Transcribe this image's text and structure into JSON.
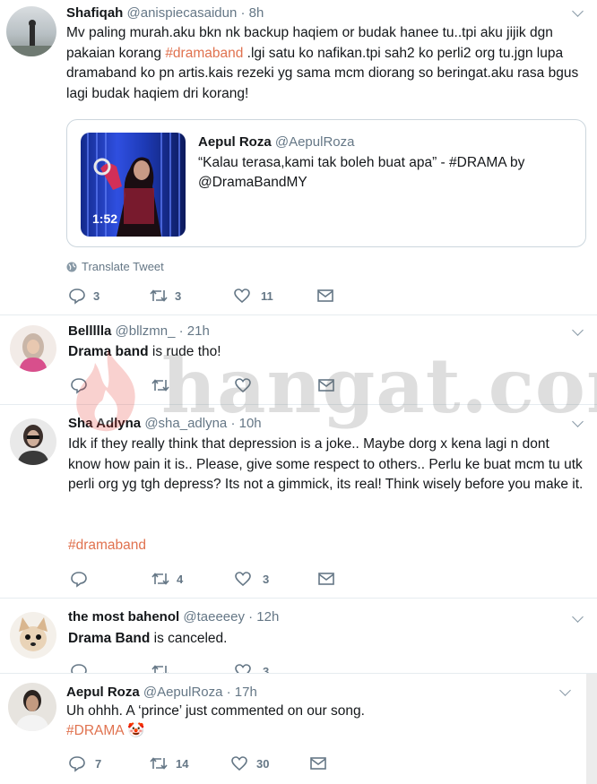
{
  "tweets": [
    {
      "name": "Shafiqah",
      "handle": "@anispiecasaidun",
      "time": "· 8h",
      "text_parts": [
        "Mv paling murah.aku bkn nk backup haqiem or budak hanee tu..tpi aku jijik dgn pakaian korang ",
        "#dramaband",
        " .lgi satu ko nafikan.tpi sah2 ko perli2 org tu.jgn lupa dramaband ko pn artis.kais rezeki yg sama mcm diorang so beringat.aku rasa bgus lagi budak haqiem dri korang!"
      ],
      "quote": {
        "name": "Aepul Roza",
        "handle": "@AepulRoza",
        "text": "“Kalau terasa,kami tak boleh buat apa” - #DRAMA by @DramaBandMY",
        "duration": "1:52"
      },
      "translate": "Translate Tweet",
      "replies": "3",
      "retweets": "3",
      "likes": "11"
    },
    {
      "name": "Bellllla",
      "handle": "@bllzmn_",
      "time": "· 21h",
      "text_bold": "Drama band",
      "text_rest": " is rude tho!"
    },
    {
      "name": "Sha Adlyna",
      "handle": "@sha_adlyna",
      "time": "· 10h",
      "text": "Idk if they really think that depression is a joke.. Maybe dorg x kena lagi n dont know how pain it is.. Please, give some respect to others.. Perlu ke buat mcm tu utk perli org yg tgh depress? Its not a gimmick, its real! Think wisely before you make it.",
      "hashtag": "#dramaband",
      "retweets": "4",
      "likes": "3"
    },
    {
      "name": "the most bahenol",
      "handle": "@taeeeey",
      "time": "· 12h",
      "text_bold": "Drama Band",
      "text_rest": " is canceled.",
      "likes": "3"
    },
    {
      "name": "Aepul Roza",
      "handle": "@AepulRoza",
      "time": "· 17h",
      "text": "Uh ohhh. A ‘prince’ just commented on our song.",
      "hashtag": "#DRAMA",
      "emoji": "🤡",
      "replies": "7",
      "retweets": "14",
      "likes": "30"
    }
  ],
  "watermark": "hangat.com",
  "colors": {
    "hashtag": "#e0724f",
    "muted": "#657786",
    "border": "#e6ecf0"
  }
}
